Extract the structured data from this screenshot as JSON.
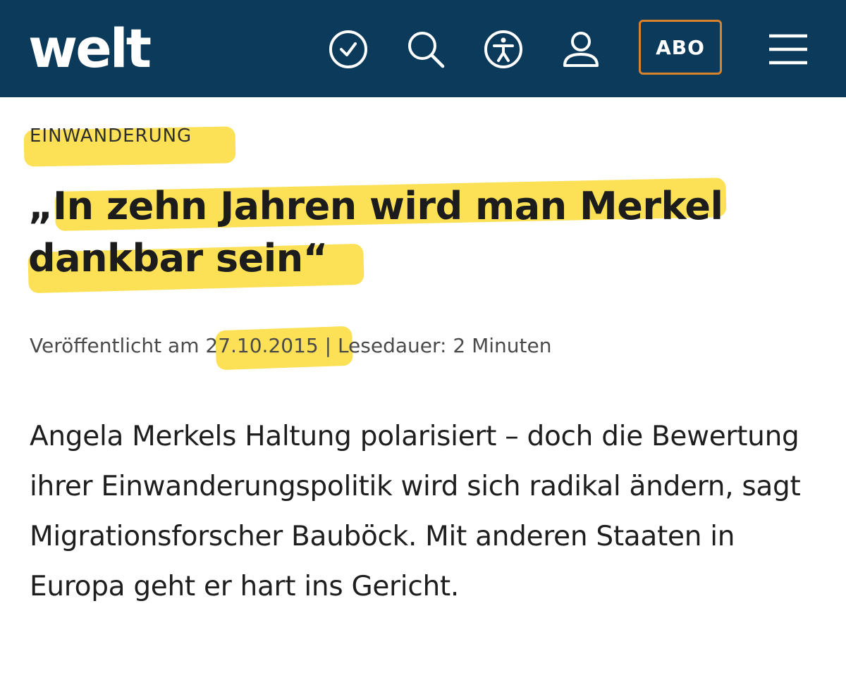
{
  "header": {
    "logo": "WeLT",
    "icons": [
      "clock-icon",
      "search-icon",
      "accessibility-icon",
      "user-icon",
      "menu-icon"
    ],
    "abo_label": "ABO",
    "background_color": "#0b3a5a",
    "abo_border_color": "#d8822a"
  },
  "article": {
    "kicker": "EINWANDERUNG",
    "headline": "„In zehn Jahren wird man Merkel dankbar sein“",
    "meta": {
      "published_prefix": "Veröffentlicht am ",
      "date": "27.10.2015",
      "separator": " | ",
      "reading_time": "Lesedauer: 2 Minuten"
    },
    "lead": "Angela Merkels Haltung polarisiert – doch die Bewertung ihrer Einwanderungspolitik wird sich radikal ändern, sagt Migrationsforscher Bauböck. Mit anderen Staaten in Europa geht er hart ins Gericht."
  },
  "highlight_color": "#fbdc3a"
}
